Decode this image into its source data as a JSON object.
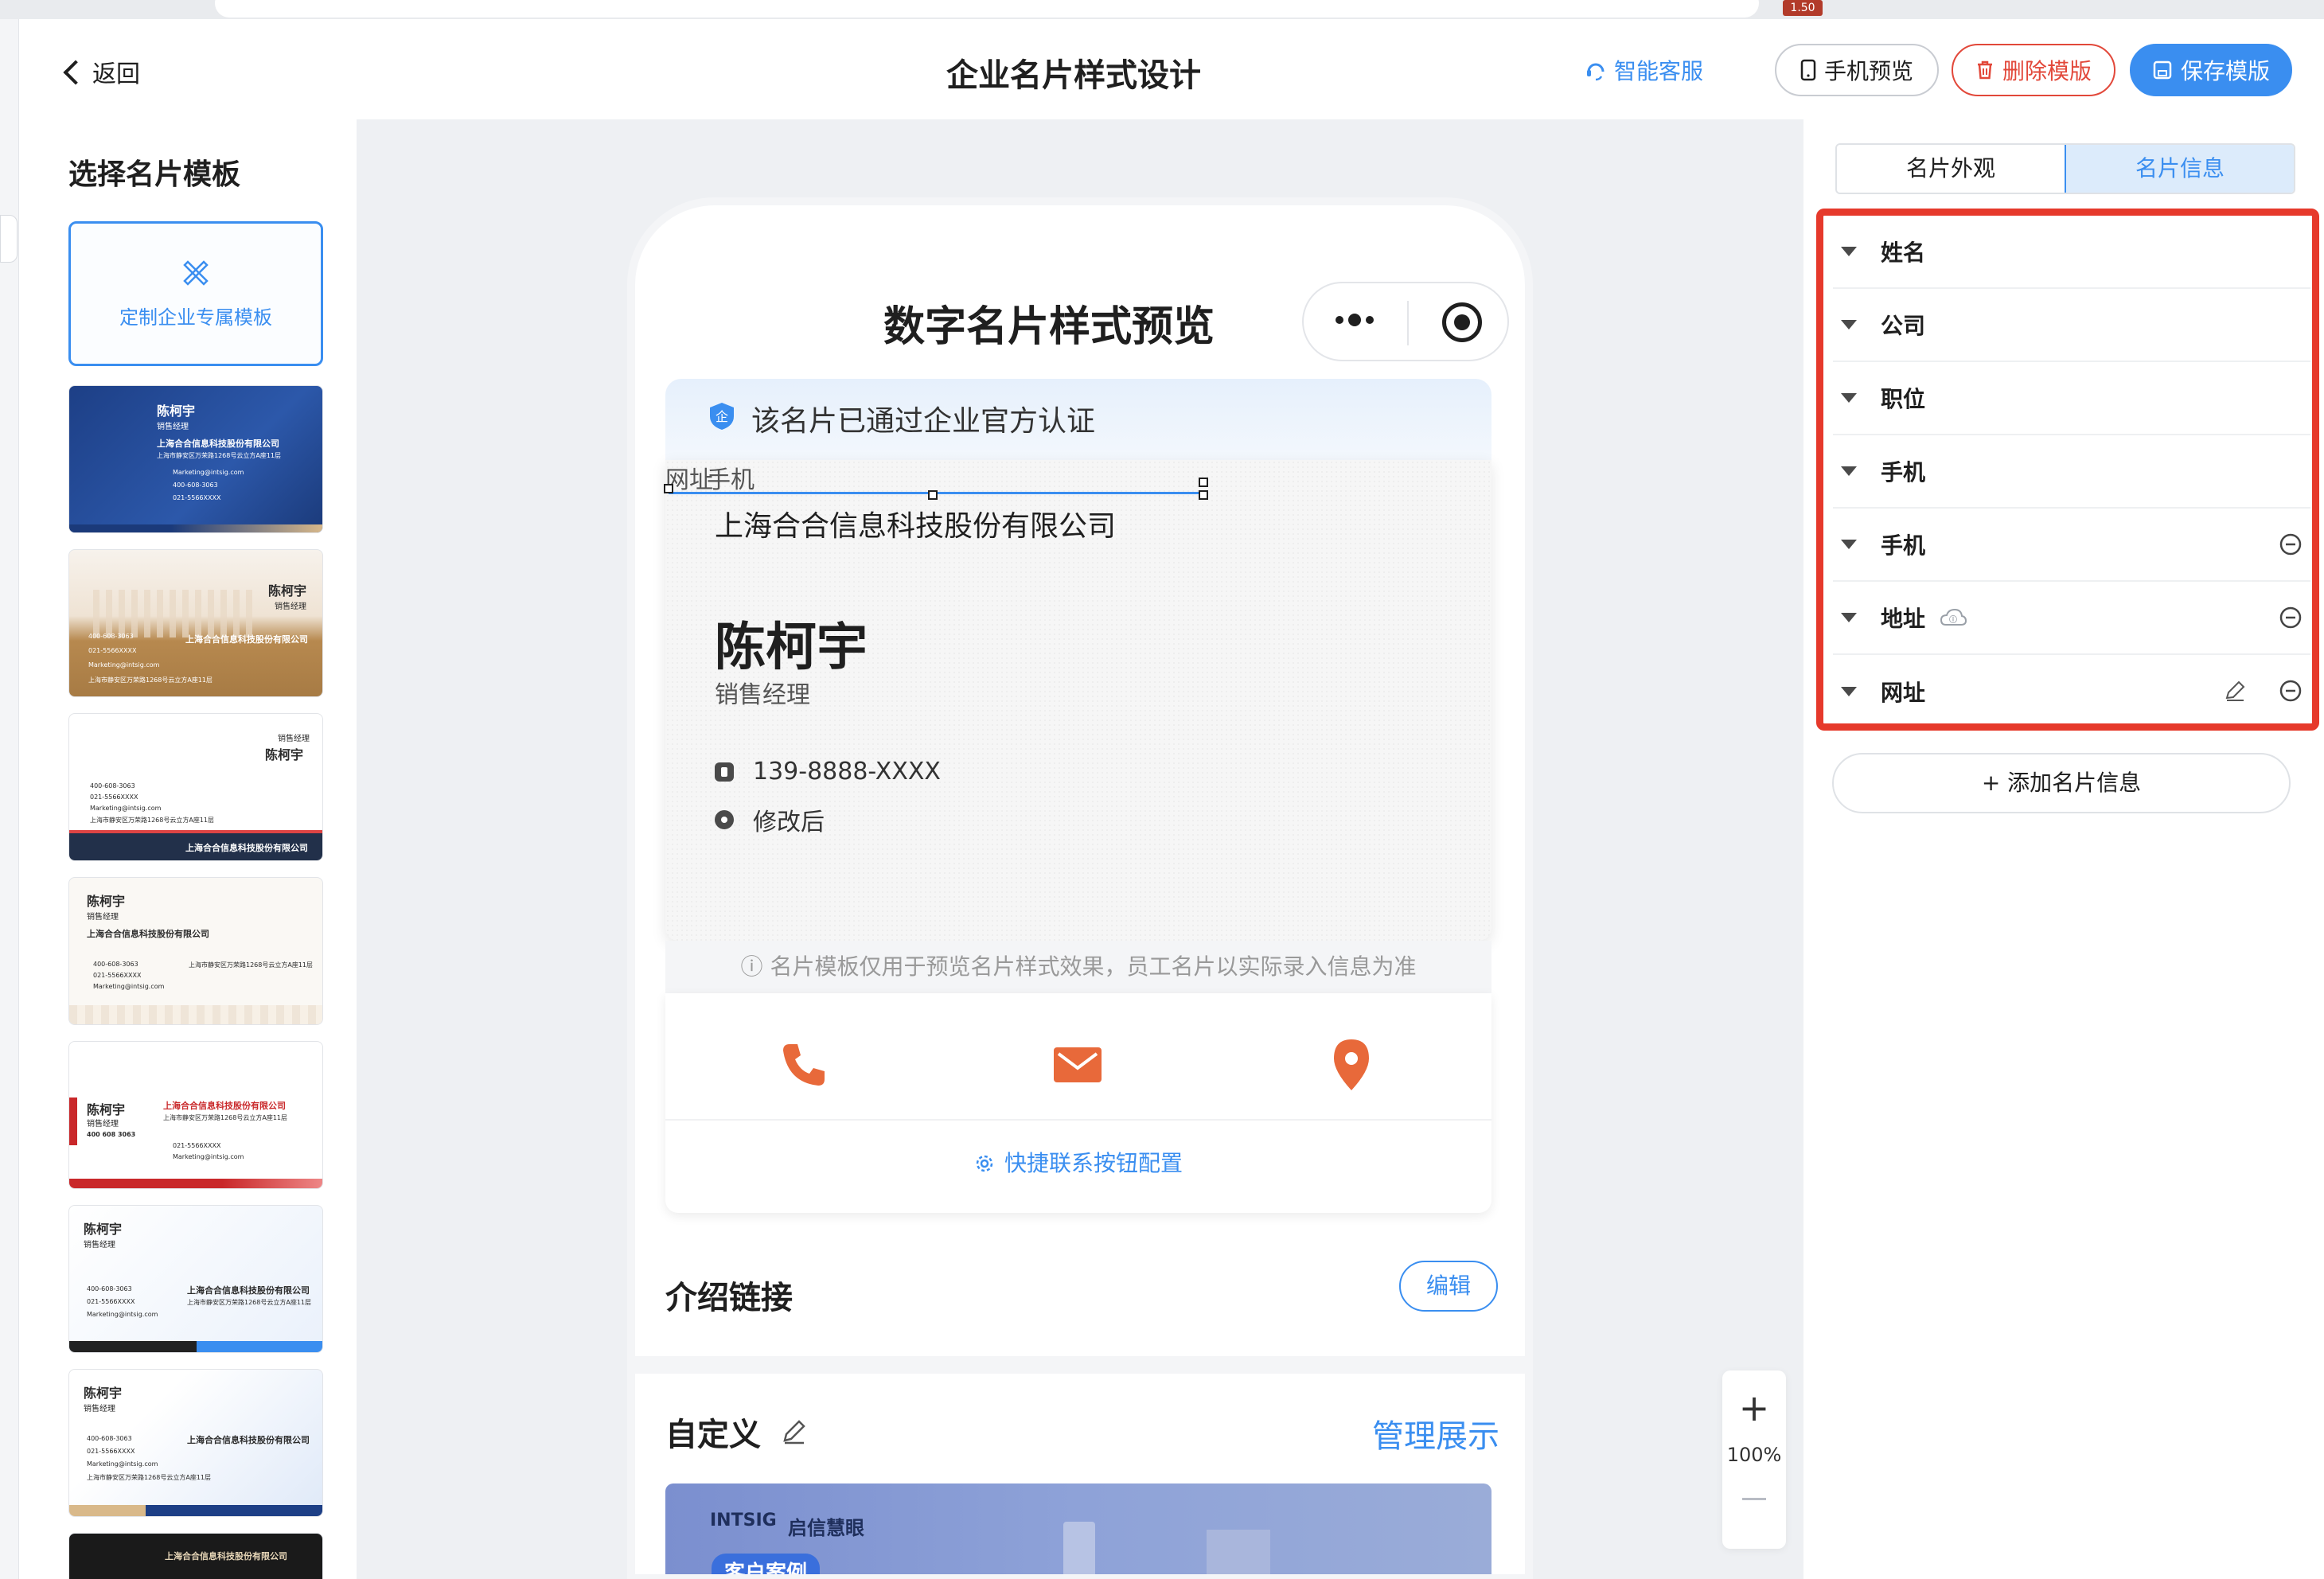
{
  "browser": {
    "badge": "1.50"
  },
  "header": {
    "back_label": "返回",
    "title": "企业名片样式设计",
    "service_link": "智能客服",
    "preview_btn": "手机预览",
    "delete_btn": "删除模版",
    "save_btn": "保存模版"
  },
  "left": {
    "title": "选择名片模板",
    "custom_label": "定制企业专属模板",
    "templates": [
      {
        "name": "陈柯宇",
        "role": "销售经理",
        "company": "上海合合信息科技股份有限公司",
        "lines": [
          "上海市静安区万荣路1268号云立方A座11层",
          "Marketing@intsig.com",
          "400-608-3063",
          "021-5566XXXX"
        ]
      },
      {
        "name": "陈柯宇",
        "role": "销售经理",
        "company": "上海合合信息科技股份有限公司",
        "lines": [
          "400-608-3063",
          "021-5566XXXX",
          "Marketing@intsig.com",
          "上海市静安区万荣路1268号云立方A座11层"
        ]
      },
      {
        "name": "陈柯宇",
        "role": "销售经理",
        "company": "上海合合信息科技股份有限公司",
        "lines": [
          "400-608-3063",
          "021-5566XXXX",
          "Marketing@intsig.com",
          "上海市静安区万荣路1268号云立方A座11层"
        ]
      },
      {
        "name": "陈柯宇",
        "role": "销售经理",
        "company": "上海合合信息科技股份有限公司",
        "lines": [
          "400-608-3063",
          "021-5566XXXX",
          "Marketing@intsig.com",
          "上海市静安区万荣路1268号云立方A座11层"
        ]
      },
      {
        "name": "陈柯宇",
        "role": "销售经理",
        "company": "上海合合信息科技股份有限公司",
        "lines": [
          "400 608 3063",
          "021-5566XXXX",
          "Marketing@intsig.com",
          "上海市静安区万荣路1268号云立方A座11层"
        ]
      },
      {
        "name": "陈柯宇",
        "role": "销售经理",
        "company": "上海合合信息科技股份有限公司",
        "lines": [
          "400-608-3063",
          "021-5566XXXX",
          "Marketing@intsig.com",
          "上海市静安区万荣路1268号云立方A座11层"
        ]
      },
      {
        "name": "陈柯宇",
        "role": "销售经理",
        "company": "上海合合信息科技股份有限公司",
        "lines": [
          "400-608-3063",
          "021-5566XXXX",
          "Marketing@intsig.com",
          "上海市静安区万荣路1268号云立方A座11层"
        ]
      },
      {
        "name": "",
        "role": "",
        "company": "上海合合信息科技股份有限公司",
        "lines": []
      }
    ]
  },
  "phone": {
    "title": "数字名片样式预览",
    "verify_text": "该名片已通过企业官方认证",
    "overlap_a": "网址",
    "overlap_b": "手机",
    "company": "上海合合信息科技股份有限公司",
    "name": "陈柯宇",
    "role": "销售经理",
    "phone": "139-8888-XXXX",
    "address": "修改后",
    "disclaimer": "ⓘ 名片模板仅用于预览名片样式效果，员工名片以实际录入信息为准",
    "quick_config": "快捷联系按钮配置",
    "intro_title": "介绍链接",
    "edit_btn": "编辑",
    "custom_title": "自定义",
    "manage_link": "管理展示",
    "banner_brand": "INTSIG",
    "banner_brand2": "启信慧眼",
    "banner_tag": "客户案例"
  },
  "zoom": {
    "plus": "+",
    "level": "100%"
  },
  "right": {
    "tab_appearance": "名片外观",
    "tab_info": "名片信息",
    "fields": [
      "姓名",
      "公司",
      "职位",
      "手机",
      "手机",
      "地址",
      "网址"
    ],
    "add_btn": "+ 添加名片信息"
  },
  "colors": {
    "accent": "#3a8ef0",
    "danger": "#e2483a",
    "highlight_box": "#e6392b",
    "contact_icon": "#e8693a"
  }
}
